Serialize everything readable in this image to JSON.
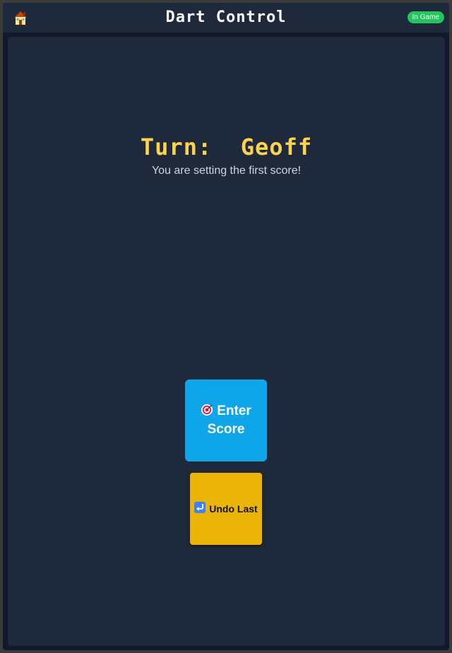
{
  "header": {
    "home_icon": "house-icon",
    "title": "Dart Control",
    "status_badge": "In Game",
    "status_color": "#22c55e"
  },
  "turn": {
    "heading": "Turn:  Geoff",
    "subtext": "You are setting the first score!"
  },
  "actions": {
    "enter_score": {
      "icon": "dartboard-target-icon",
      "label": "Enter Score",
      "color": "#0ea5e9"
    },
    "undo_last": {
      "icon": "return-arrow-icon",
      "label": "Undo Last",
      "color": "#eab308"
    }
  },
  "colors": {
    "background": "#111a2b",
    "panel": "#1e293b",
    "heading": "#fcd34d"
  }
}
